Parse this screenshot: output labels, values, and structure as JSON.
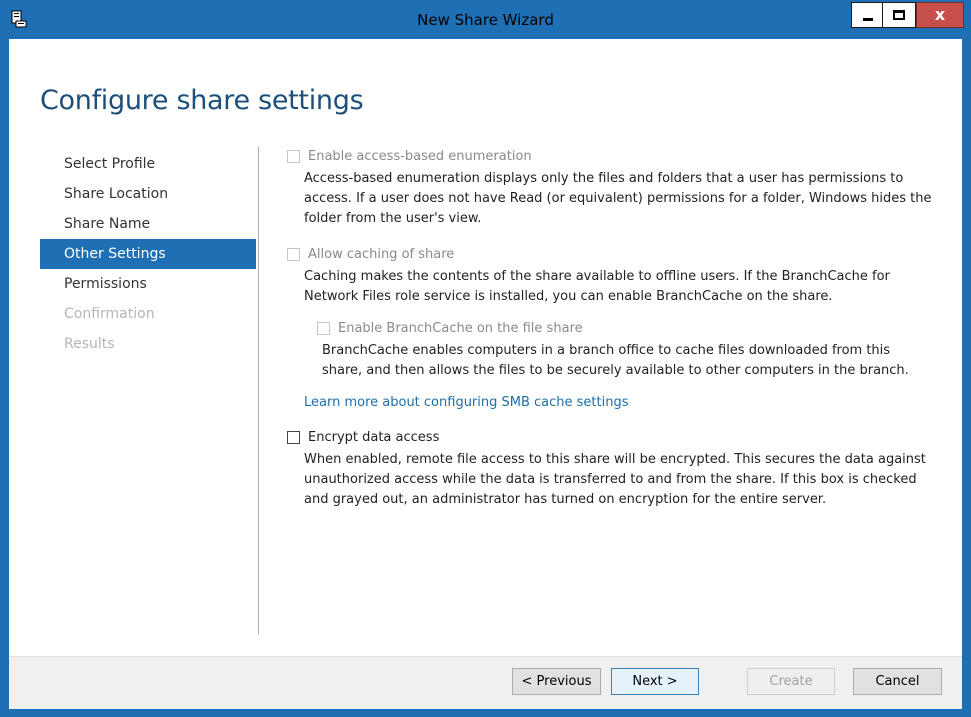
{
  "window": {
    "title": "New Share Wizard"
  },
  "header": {
    "title": "Configure share settings"
  },
  "nav": {
    "items": [
      {
        "label": "Select Profile",
        "state": "normal"
      },
      {
        "label": "Share Location",
        "state": "normal"
      },
      {
        "label": "Share Name",
        "state": "normal"
      },
      {
        "label": "Other Settings",
        "state": "active"
      },
      {
        "label": "Permissions",
        "state": "normal"
      },
      {
        "label": "Confirmation",
        "state": "disabled"
      },
      {
        "label": "Results",
        "state": "disabled"
      }
    ]
  },
  "options": {
    "abe": {
      "label": "Enable access-based enumeration",
      "desc1": "Access-based enumeration displays only the files and folders that a user has permissions to",
      "desc2": "access. If a user does not have Read (or equivalent) permissions for a folder, Windows hides the",
      "desc3": "folder from the user's view."
    },
    "caching": {
      "label": "Allow caching of share",
      "desc1": "Caching makes the contents of the share available to offline users. If the BranchCache for",
      "desc2": "Network Files role service is installed, you can enable BranchCache on the share."
    },
    "branchcache": {
      "label": "Enable BranchCache on the file share",
      "desc1": "BranchCache enables computers in a branch office to cache files downloaded from this",
      "desc2": "share, and then allows the files to be securely available to other computers in the branch."
    },
    "learn_more": "Learn more about configuring SMB cache settings",
    "encrypt": {
      "label": "Encrypt data access",
      "desc1": "When enabled, remote file access to this share will be encrypted. This secures the data against",
      "desc2": "unauthorized access while the data is transferred to and from the share. If this box is checked",
      "desc3": "and grayed out, an administrator has turned on encryption for the entire server."
    }
  },
  "buttons": {
    "previous": "< Previous",
    "next": "Next >",
    "create": "Create",
    "cancel": "Cancel"
  },
  "colors": {
    "accent": "#1f6fb5",
    "title": "#1e4f7a",
    "link": "#1e6fa7"
  }
}
